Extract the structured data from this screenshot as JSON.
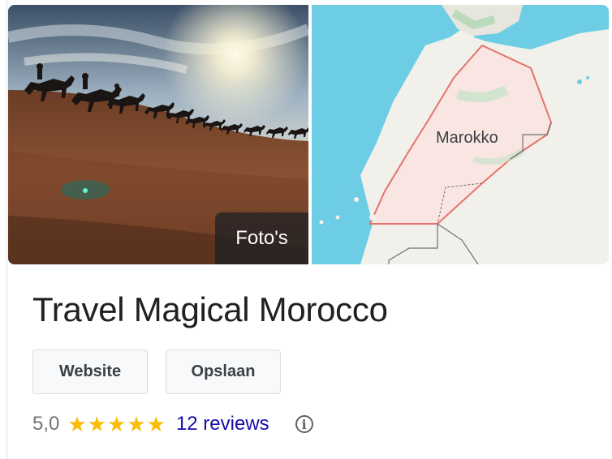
{
  "photo": {
    "photos_label": "Foto's"
  },
  "map": {
    "region_label": "Marokko"
  },
  "business": {
    "name": "Travel Magical Morocco",
    "buttons": {
      "website": "Website",
      "save": "Opslaan"
    },
    "rating": {
      "value": "5,0",
      "stars": 5,
      "reviews": "12 reviews",
      "star_color": "#fbbc04",
      "link_color": "#1a0dab"
    }
  },
  "icons": [
    "star-icon",
    "info-icon"
  ]
}
